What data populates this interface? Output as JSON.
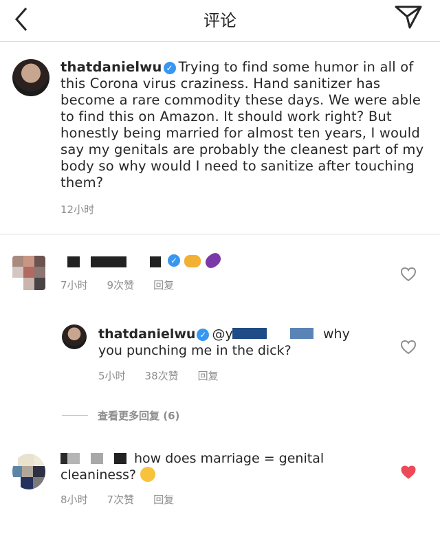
{
  "header": {
    "title": "评论"
  },
  "post": {
    "username": "thatdanielwu",
    "caption": "Trying to find some humor in all of this Corona virus craziness. Hand sanitizer has become a rare commodity these days. We were able to find this on Amazon. It should work right? But honestly being married for almost ten years, I would say my genitals are probably the cleanest part of my body so why would I need to sanitize after touching them?",
    "time": "12小时"
  },
  "comments": [
    {
      "time": "7小时",
      "likes": "9次赞",
      "reply_label": "回复",
      "liked": false
    },
    {
      "username": "thatdanielwu",
      "mention": "@y",
      "text_a": "why",
      "text_b": "you punching me in the dick?",
      "time": "5小时",
      "likes": "38次赞",
      "reply_label": "回复",
      "liked": false
    },
    {
      "text_a": "how does marriage = genital",
      "text_b": "cleaniness?",
      "time": "8小时",
      "likes": "7次赞",
      "reply_label": "回复",
      "liked": true
    }
  ],
  "view_more": "查看更多回复 (6)",
  "colors": {
    "verified": "#3897f0",
    "liked_heart": "#ed4956",
    "meta": "#8e8e8e"
  }
}
